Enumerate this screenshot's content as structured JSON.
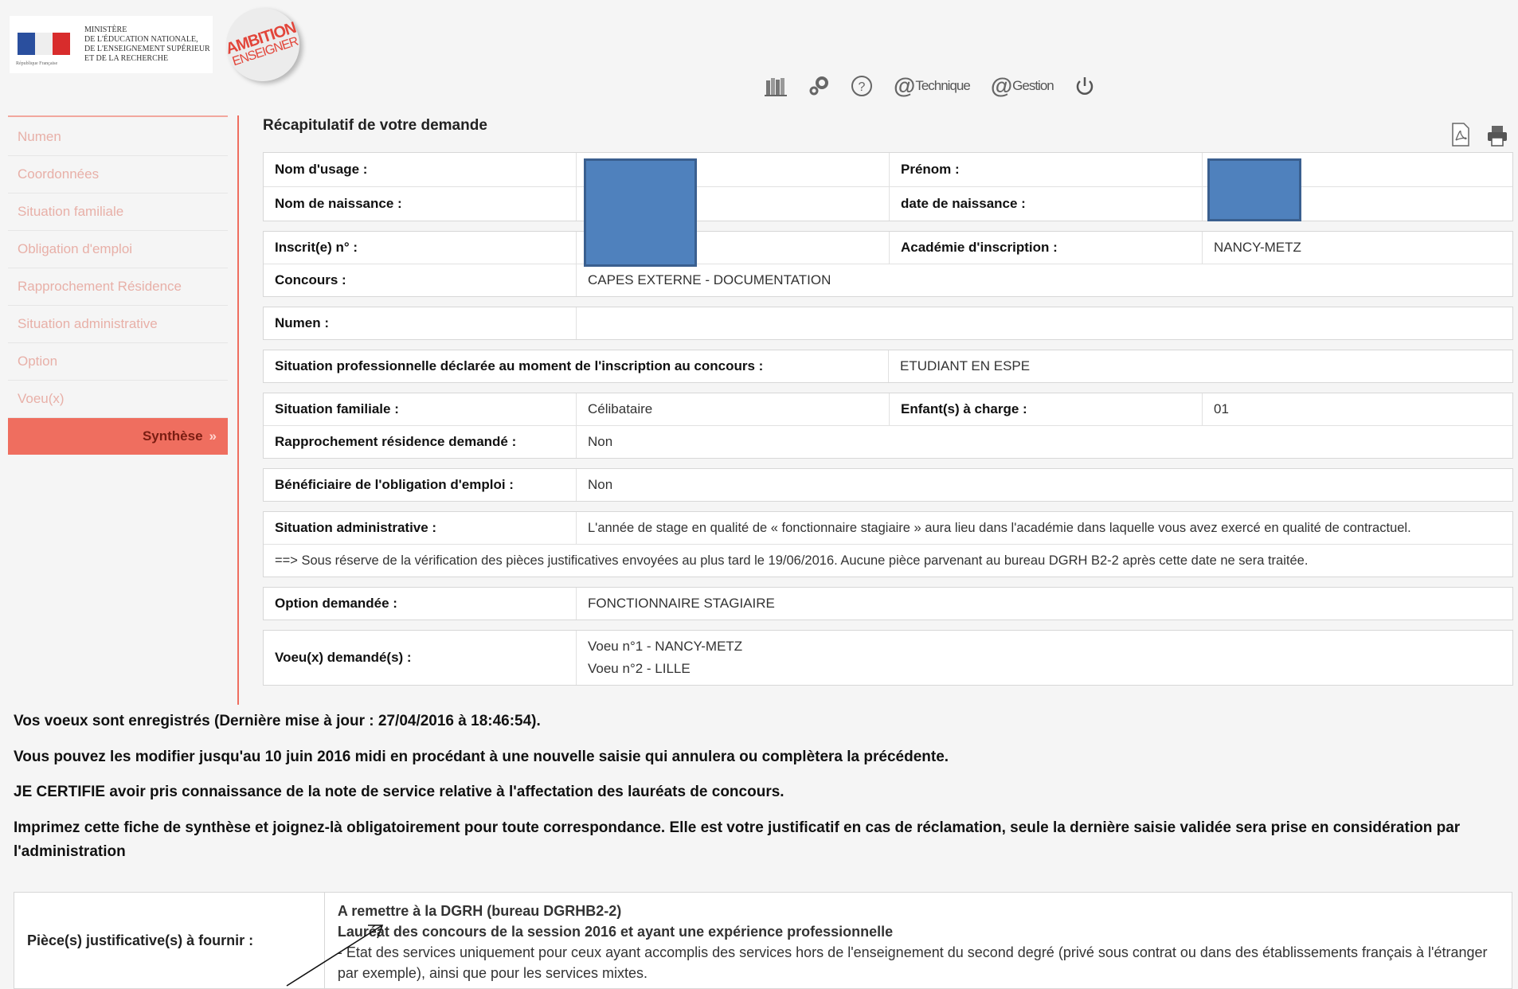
{
  "header": {
    "ministry_text": "Ministère\nde l'Éducation nationale,\nde l'Enseignement supérieur\net de la Recherche",
    "republique_text": "République Française",
    "ambition_line1": "AMBITION",
    "ambition_line2": "ENSEIGNER",
    "toolbar": {
      "technique_label": "Technique",
      "gestion_label": "Gestion"
    }
  },
  "sidebar": {
    "items": [
      {
        "label": "Numen"
      },
      {
        "label": "Coordonnées"
      },
      {
        "label": "Situation familiale"
      },
      {
        "label": "Obligation d'emploi"
      },
      {
        "label": "Rapprochement Résidence"
      },
      {
        "label": "Situation administrative"
      },
      {
        "label": "Option"
      },
      {
        "label": "Voeu(x)"
      },
      {
        "label": "Synthèse",
        "arrow": "»"
      }
    ]
  },
  "summary": {
    "title": "Récapitulatif de votre demande",
    "nom_usage_label": "Nom d'usage :",
    "prenom_label": "Prénom :",
    "nom_naissance_label": "Nom de naissance :",
    "date_naissance_label": "date de naissance :",
    "inscrit_label": "Inscrit(e) n° :",
    "academie_label": "Académie d'inscription :",
    "academie_value": "NANCY-METZ",
    "concours_label": "Concours :",
    "concours_value": "CAPES EXTERNE - DOCUMENTATION",
    "numen_label": "Numen :",
    "numen_value": "",
    "situation_pro_label": "Situation professionnelle déclarée au moment de l'inscription au concours :",
    "situation_pro_value": "ETUDIANT EN ESPE",
    "situation_fam_label": "Situation familiale :",
    "situation_fam_value": "Célibataire",
    "enfants_label": "Enfant(s) à charge :",
    "enfants_value": "01",
    "rapprochement_label": "Rapprochement résidence demandé :",
    "rapprochement_value": "Non",
    "obligation_label": "Bénéficiaire de l'obligation d'emploi :",
    "obligation_value": "Non",
    "situation_admin_label": "Situation administrative :",
    "situation_admin_value": "L'année de stage en qualité de « fonctionnaire stagiaire » aura lieu dans l'académie dans laquelle vous avez exercé en qualité de contractuel.",
    "reserve_note": "==> Sous réserve de la vérification des pièces justificatives envoyées au plus tard le 19/06/2016. Aucune pièce parvenant au bureau DGRH B2-2 après cette date ne sera traitée.",
    "option_label": "Option demandée :",
    "option_value": "FONCTIONNAIRE STAGIAIRE",
    "voeux_label": "Voeu(x) demandé(s) :",
    "voeu1": "Voeu n°1 - NANCY-METZ",
    "voeu2": "Voeu n°2 - LILLE"
  },
  "messages": {
    "m1": "Vos voeux sont enregistrés (Dernière mise à jour : 27/04/2016 à 18:46:54).",
    "m2": "Vous pouvez les modifier jusqu'au 10 juin 2016 midi en procédant à une nouvelle saisie qui annulera ou complètera la précédente.",
    "m3": "JE CERTIFIE avoir pris connaissance de la note de service relative à l'affectation des lauréats de concours.",
    "m4": "Imprimez cette fiche de synthèse et joignez-là obligatoirement pour toute correspondance. Elle est votre justificatif en cas de réclamation, seule la dernière saisie validée sera prise en considération par l'administration"
  },
  "pieces": {
    "label": "Pièce(s) justificative(s) à fournir :",
    "line1": "A remettre à la DGRH (bureau DGRHB2-2)",
    "line2": "Lauréat des concours de la session 2016 et ayant une expérience professionnelle",
    "line3": "- Etat des services uniquement pour ceux ayant accomplis des services hors de l'enseignement du second degré (privé sous contrat ou dans des établissements français à l'étranger par exemple), ainsi que pour les services mixtes."
  },
  "colors": {
    "accent": "#ef6e5f",
    "redaction": "#4f81bd"
  }
}
